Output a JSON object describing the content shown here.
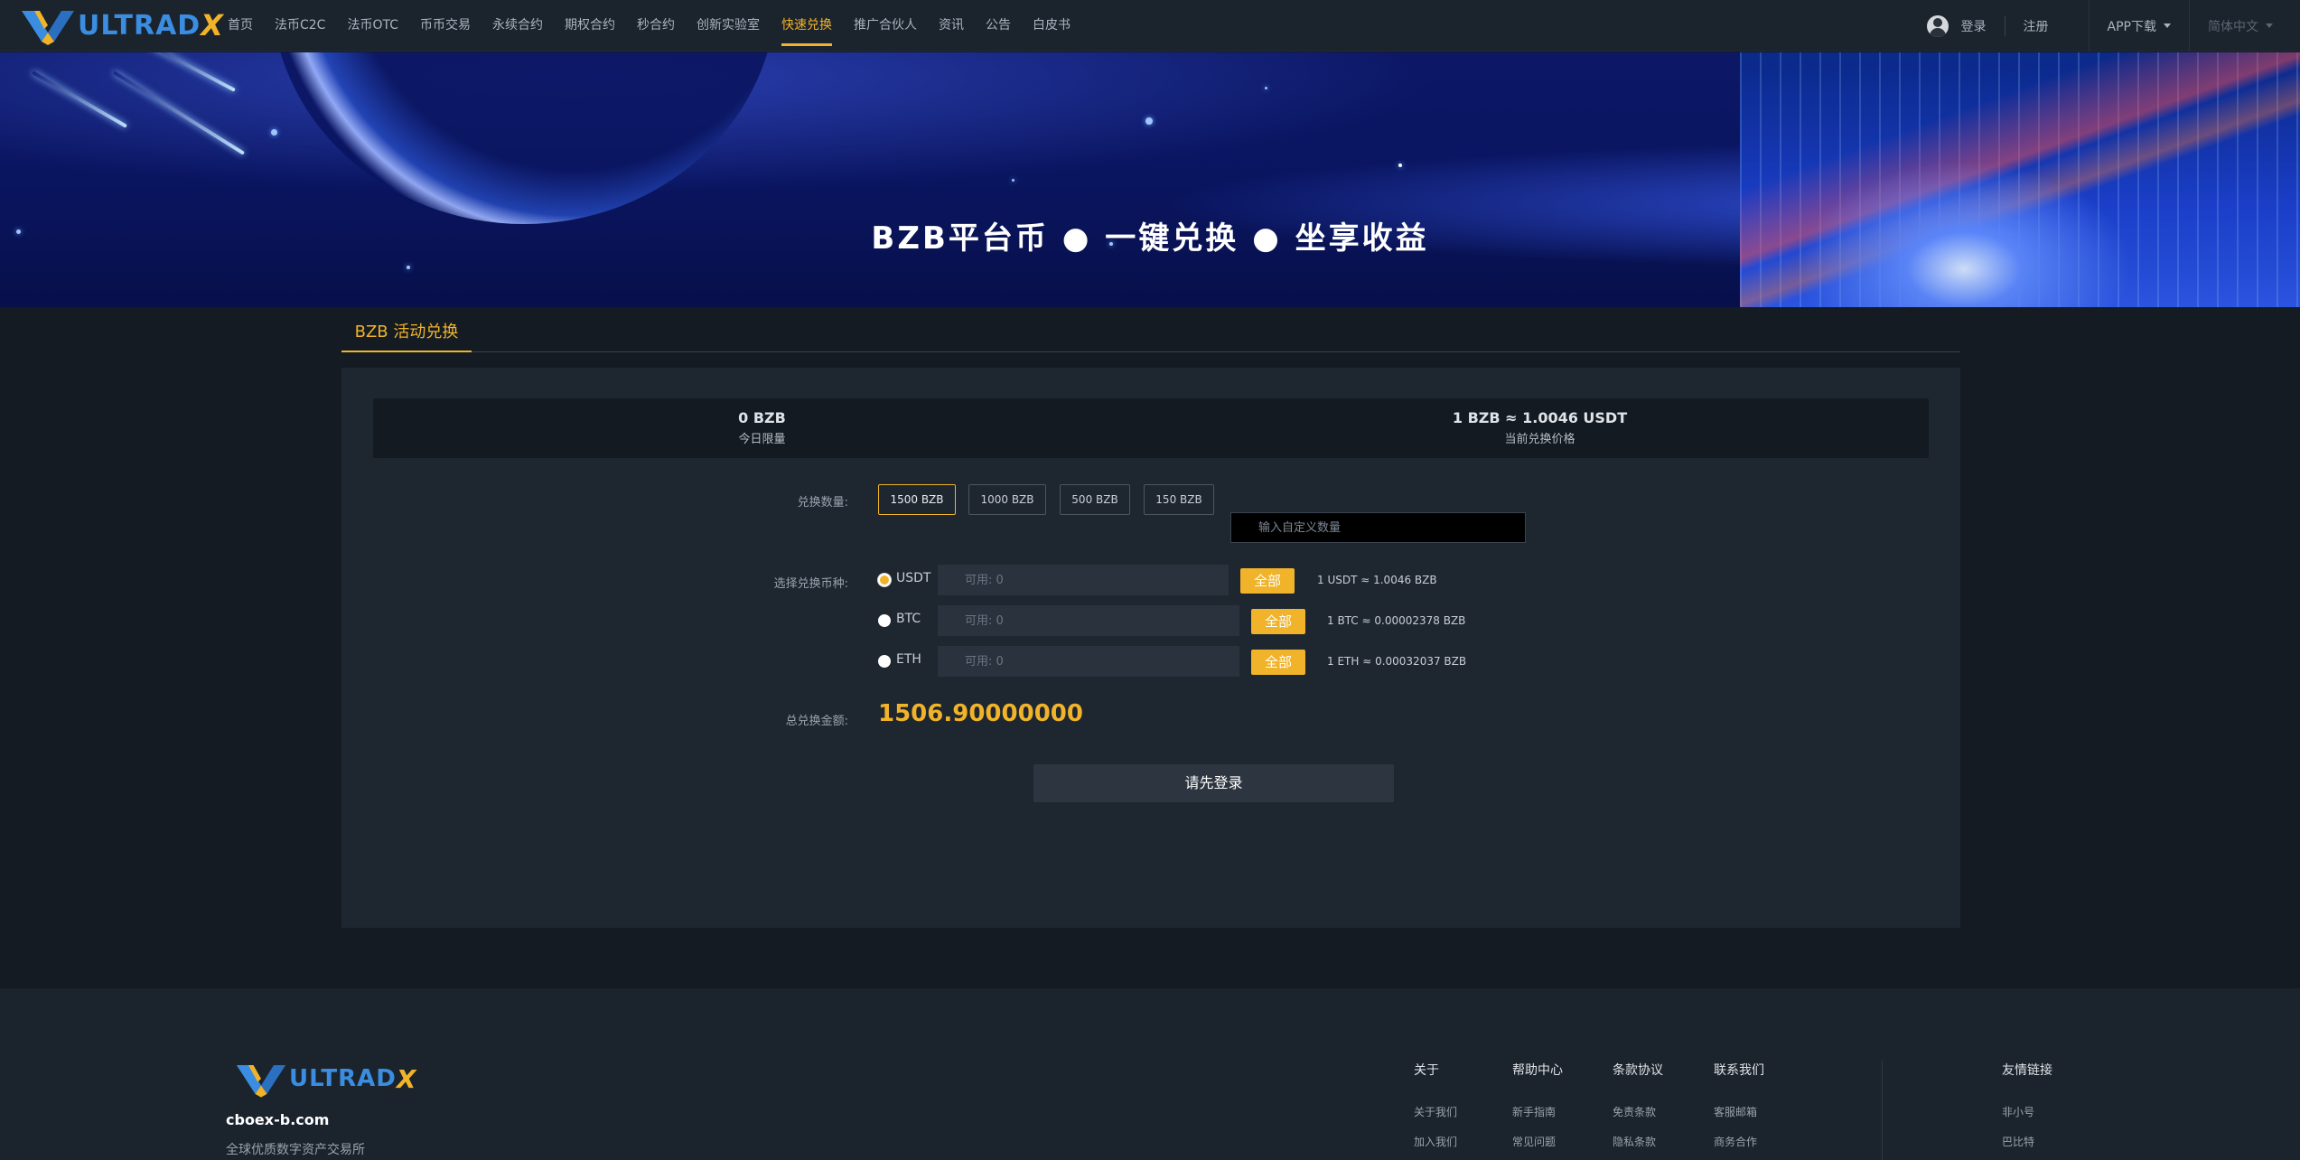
{
  "nav": {
    "logo_text": "ULTRAD",
    "logo_x": "X",
    "menu": [
      {
        "label": "首页"
      },
      {
        "label": "法币C2C"
      },
      {
        "label": "法币OTC"
      },
      {
        "label": "币币交易"
      },
      {
        "label": "永续合约"
      },
      {
        "label": "期权合约"
      },
      {
        "label": "秒合约"
      },
      {
        "label": "创新实验室"
      },
      {
        "label": "快速兑换",
        "active": true
      },
      {
        "label": "推广合伙人"
      },
      {
        "label": "资讯"
      },
      {
        "label": "公告"
      },
      {
        "label": "白皮书"
      }
    ],
    "login": "登录",
    "register": "注册",
    "app_download": "APP下载",
    "language": "简体中文"
  },
  "banner": {
    "title": "BZB平台币 ● 一键兑换 ● 坐享收益"
  },
  "tab": {
    "label": "BZB 活动兑换"
  },
  "stats": {
    "daily_limit_value": "0 BZB",
    "daily_limit_label": "今日限量",
    "price_value": "1 BZB ≈ 1.0046 USDT",
    "price_label": "当前兑换价格"
  },
  "exchange": {
    "amount_label": "兑换数量:",
    "amount_options": [
      "1500 BZB",
      "1000 BZB",
      "500 BZB",
      "150 BZB"
    ],
    "selected_amount": "1500 BZB",
    "custom_placeholder": "输入自定义数量",
    "currency_label": "选择兑换币种:",
    "currencies": [
      {
        "name": "USDT",
        "available_placeholder": "可用: 0",
        "all_label": "全部",
        "rate": "1 USDT ≈ 1.0046 BZB",
        "checked": true
      },
      {
        "name": "BTC",
        "available_placeholder": "可用: 0",
        "all_label": "全部",
        "rate": "1 BTC ≈ 0.00002378 BZB",
        "checked": false
      },
      {
        "name": "ETH",
        "available_placeholder": "可用: 0",
        "all_label": "全部",
        "rate": "1 ETH ≈ 0.00032037 BZB",
        "checked": false
      }
    ],
    "total_label": "总兑换金额:",
    "total_value": "1506.90000000",
    "login_button": "请先登录"
  },
  "footer": {
    "domain": "cboex-b.com",
    "slogan": "全球优质数字资产交易所",
    "columns": [
      {
        "title": "关于",
        "links": [
          "关于我们",
          "加入我们"
        ]
      },
      {
        "title": "帮助中心",
        "links": [
          "新手指南",
          "常见问题"
        ]
      },
      {
        "title": "条款协议",
        "links": [
          "免责条款",
          "隐私条款"
        ]
      },
      {
        "title": "联系我们",
        "links": [
          "客服邮箱",
          "商务合作"
        ]
      },
      {
        "title": "友情链接",
        "links": [
          "非小号",
          "巴比特"
        ]
      }
    ]
  },
  "colors": {
    "accent": "#f0b329",
    "nav_bg": "#1b232c",
    "page_bg": "#141b23",
    "panel_bg": "#1e2630"
  }
}
